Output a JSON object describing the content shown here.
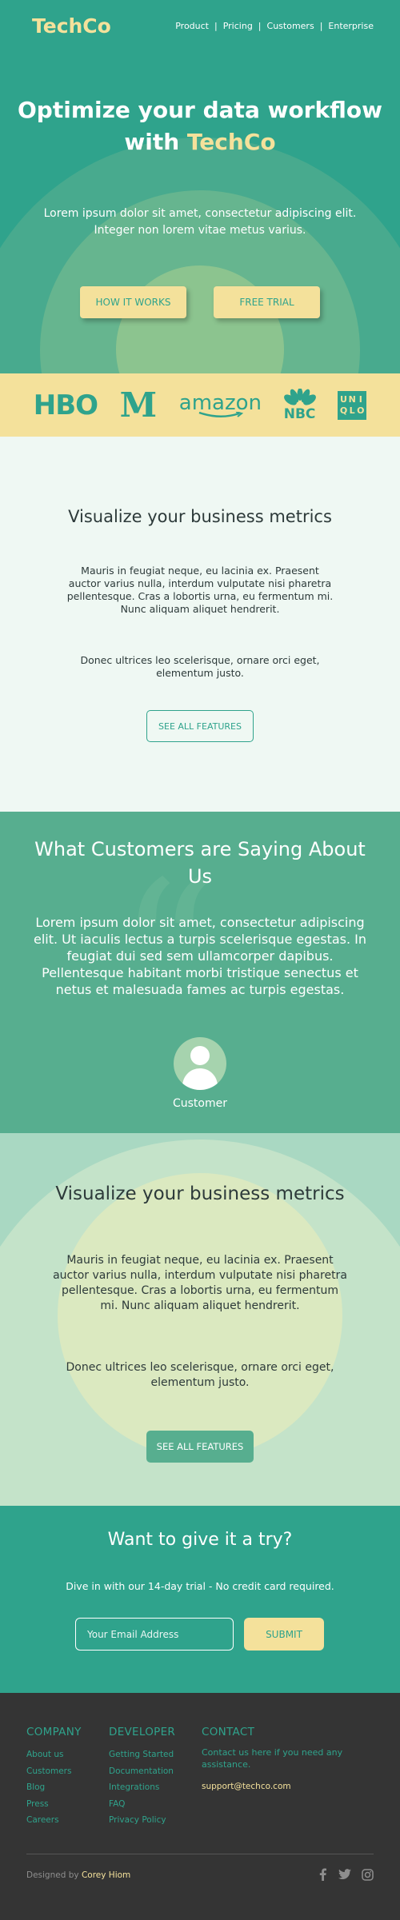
{
  "header": {
    "logo": "TechCo",
    "nav": [
      "Product",
      "Pricing",
      "Customers",
      "Enterprise"
    ],
    "nav_separator": "|"
  },
  "hero": {
    "title_line1": "Optimize your data workflow",
    "title_with": "with",
    "title_accent": "TechCo",
    "subtitle": "Lorem ipsum dolor sit amet, consectetur adipiscing elit. Integer non lorem vitae metus varius.",
    "button_how": "HOW IT WORKS",
    "button_trial": "FREE TRIAL"
  },
  "logos": {
    "hbo": "HBO",
    "mcdonalds": "M",
    "amazon": "amazon",
    "nbc": "NBC",
    "uniqlo": [
      "U",
      "N",
      "I",
      "Q",
      "L",
      "O"
    ]
  },
  "features1": {
    "title": "Visualize your business metrics",
    "p1": "Mauris in feugiat neque, eu lacinia ex. Praesent auctor varius nulla, interdum vulputate nisi pharetra pellentesque. Cras a lobortis urna, eu fermentum mi. Nunc aliquam aliquet hendrerit.",
    "p2": "Donec ultrices leo scelerisque, ornare orci eget, elementum justo.",
    "button": "SEE ALL FEATURES"
  },
  "testimonial": {
    "title": "What Customers are Saying About Us",
    "quote": "Lorem ipsum dolor sit amet, consectetur adipiscing elit. Ut iaculis lectus a turpis scelerisque egestas. In feugiat dui sed sem ullamcorper dapibus. Pellentesque habitant morbi tristique senectus et netus et malesuada fames ac turpis egestas.",
    "customer_name": "Customer"
  },
  "features2": {
    "title": "Visualize your business metrics",
    "p1": "Mauris in feugiat neque, eu lacinia ex. Praesent auctor varius nulla, interdum vulputate nisi pharetra pellentesque. Cras a lobortis urna, eu fermentum mi. Nunc aliquam aliquet hendrerit.",
    "p2": "Donec ultrices leo scelerisque, ornare orci eget, elementum justo.",
    "button": "SEE ALL FEATURES"
  },
  "cta": {
    "title": "Want to give it a try?",
    "subtitle": "Dive in with our 14-day trial - No credit card required.",
    "email_placeholder": "Your Email Address",
    "submit": "SUBMIT"
  },
  "footer": {
    "company": {
      "heading": "COMPANY",
      "links": [
        "About us",
        "Customers",
        "Blog",
        "Press",
        "Careers"
      ]
    },
    "developer": {
      "heading": "DEVELOPER",
      "links": [
        "Getting Started",
        "Documentation",
        "Integrations",
        "FAQ",
        "Privacy Policy"
      ]
    },
    "contact": {
      "heading": "CONTACT",
      "text": "Contact us here if you need any assistance.",
      "email": "support@techco.com"
    },
    "credit_prefix": "Designed by",
    "credit_author": "Corey Hiom",
    "socials": [
      "facebook-icon",
      "twitter-icon",
      "instagram-icon"
    ]
  },
  "colors": {
    "primary": "#2fa38c",
    "accent": "#f4e19b",
    "medium_green": "#57ae8f",
    "light_bg": "#eff8f3",
    "footer_bg": "#343434"
  }
}
